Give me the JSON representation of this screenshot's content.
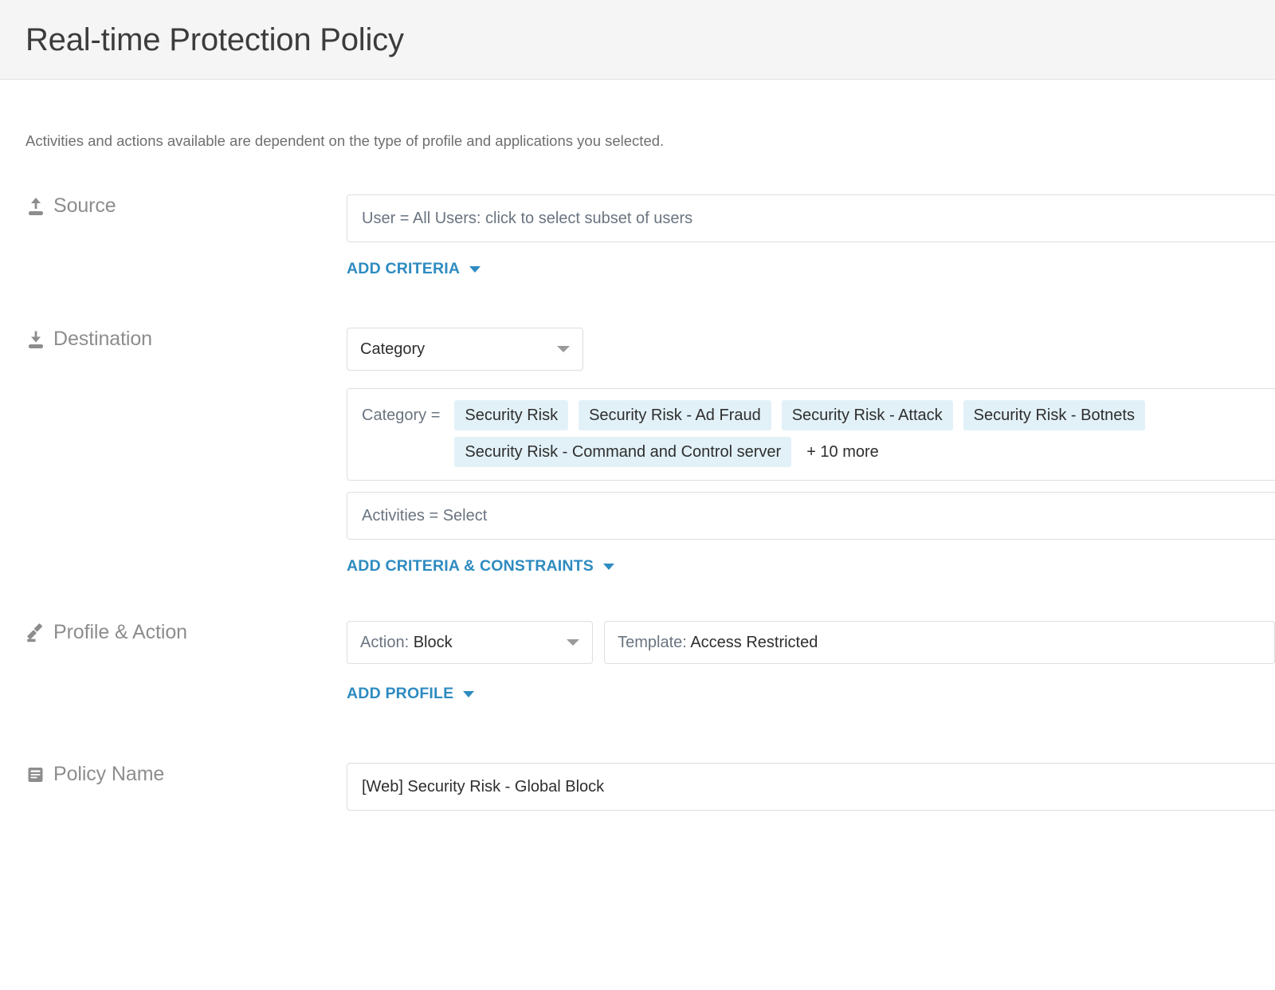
{
  "header": {
    "title": "Real-time Protection Policy"
  },
  "intro": {
    "text": "Activities and actions available are dependent on the type of profile and applications you selected."
  },
  "colors": {
    "link": "#2e8bc0",
    "chip_bg": "#e2f1f8",
    "header_bg": "#f5f5f5",
    "label_gray": "#8d8d8d",
    "field_border": "#dedede"
  },
  "sections": {
    "source": {
      "label": "Source",
      "icon": "upload-icon",
      "field_value": "User = All Users: click to select subset of users",
      "add_link": "ADD CRITERIA"
    },
    "destination": {
      "label": "Destination",
      "icon": "download-icon",
      "type_select": "Category",
      "criteria_key": "Category =",
      "chips": [
        "Security Risk",
        "Security Risk - Ad Fraud",
        "Security Risk - Attack",
        "Security Risk - Botnets",
        "Security Risk - Command and Control server"
      ],
      "more_label": "+ 10 more",
      "activities_value": "Activities = Select",
      "add_link": "ADD CRITERIA & CONSTRAINTS"
    },
    "profile_action": {
      "label": "Profile & Action",
      "icon": "gavel-icon",
      "action_prefix": "Action:",
      "action_value": "Block",
      "template_prefix": "Template:",
      "template_value": "Access Restricted",
      "add_link": "ADD PROFILE"
    },
    "policy_name": {
      "label": "Policy Name",
      "icon": "document-list-icon",
      "value": "[Web] Security Risk - Global Block"
    }
  }
}
